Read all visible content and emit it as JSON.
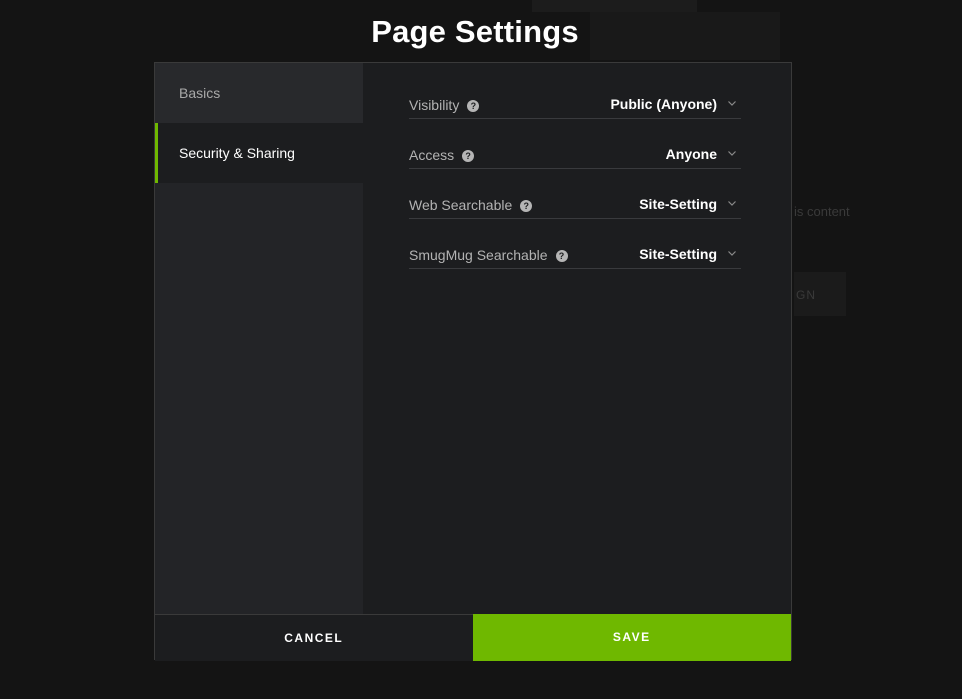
{
  "page": {
    "title": "Page Settings"
  },
  "background": {
    "faded_text_1": "is content",
    "faded_text_2": "GN"
  },
  "sidebar": {
    "items": [
      {
        "label": "Basics",
        "active": false
      },
      {
        "label": "Security & Sharing",
        "active": true
      }
    ]
  },
  "settings": {
    "rows": [
      {
        "label": "Visibility",
        "value": "Public (Anyone)"
      },
      {
        "label": "Access",
        "value": "Anyone"
      },
      {
        "label": "Web Searchable",
        "value": "Site-Setting"
      },
      {
        "label": "SmugMug Searchable",
        "value": "Site-Setting"
      }
    ]
  },
  "footer": {
    "cancel_label": "CANCEL",
    "save_label": "SAVE"
  },
  "icons": {
    "help": "question-circle-icon",
    "dropdown": "chevron-down-icon"
  },
  "colors": {
    "accent": "#6fb800",
    "background": "#141414",
    "panel": "#1c1d1f",
    "sidebar": "#232427"
  }
}
